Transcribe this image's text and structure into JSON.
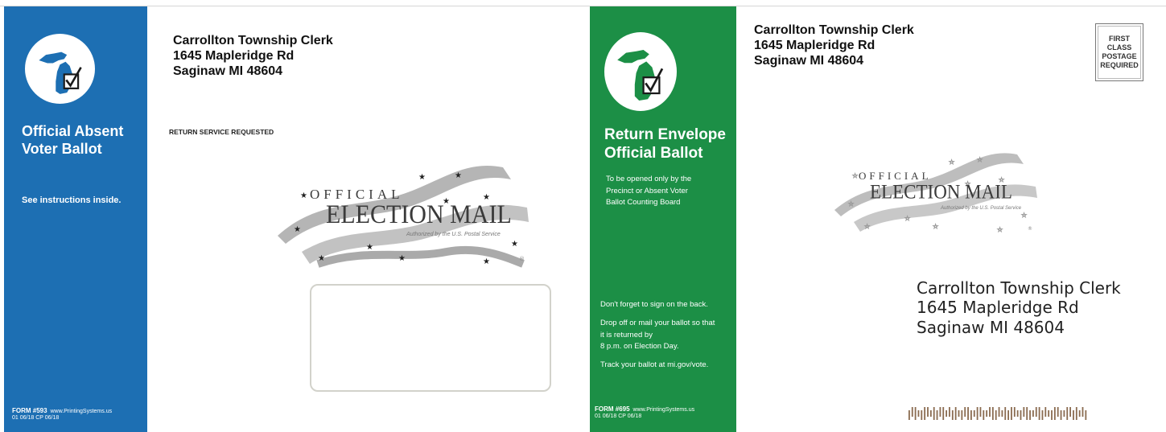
{
  "colors": {
    "blue_band": "#1d6fb3",
    "green_band": "#1c8f46",
    "seal_gray": "#a9a9a9"
  },
  "outgoing_envelope": {
    "band": {
      "logo_icon": "michigan-checkbox-icon",
      "title_line1": "Official Absent",
      "title_line2": "Voter Ballot",
      "instructions": "See instructions inside.",
      "form_number": "FORM #593",
      "printer": "www.PrintingSystems.us",
      "form_dates": "01 06/18  CP 06/18"
    },
    "return_address": {
      "line1": "Carrollton Township Clerk",
      "line2": "1645 Mapleridge Rd",
      "line3": "Saginaw MI 48604"
    },
    "endorsement": "RETURN SERVICE REQUESTED",
    "seal": {
      "top_word": "OFFICIAL",
      "main_words": "ELECTION MAIL",
      "authorized": "Authorized by the U.S. Postal Service"
    }
  },
  "return_envelope": {
    "band": {
      "logo_icon": "michigan-checkbox-icon",
      "title_line1": "Return Envelope",
      "title_line2": "Official Ballot",
      "subtitle_line1": "To be opened only by the",
      "subtitle_line2": "Precinct or Absent Voter",
      "subtitle_line3": "Ballot Counting Board",
      "note_sign": "Don't forget to sign on the back.",
      "note_drop1": "Drop off or mail your ballot so that",
      "note_drop2": "it is returned by",
      "note_drop3": "8 p.m. on Election Day.",
      "note_track": "Track your ballot at mi.gov/vote.",
      "form_number": "FORM #695",
      "printer": "www.PrintingSystems.us",
      "form_dates": "01 06/18  CP 06/18"
    },
    "return_address": {
      "line1": "Carrollton Township Clerk",
      "line2": "1645 Mapleridge Rd",
      "line3": "Saginaw MI 48604"
    },
    "postage": {
      "line1": "FIRST",
      "line2": "CLASS",
      "line3": "POSTAGE",
      "line4": "REQUIRED"
    },
    "seal": {
      "top_word": "OFFICIAL",
      "main_words": "ELECTION MAIL",
      "authorized": "Authorized by the U.S. Postal Service"
    },
    "destination_address": {
      "line1": "Carrollton Township Clerk",
      "line2": "1645 Mapleridge Rd",
      "line3": "Saginaw MI 48604"
    },
    "barcode_icon": "postal-barcode-icon"
  }
}
